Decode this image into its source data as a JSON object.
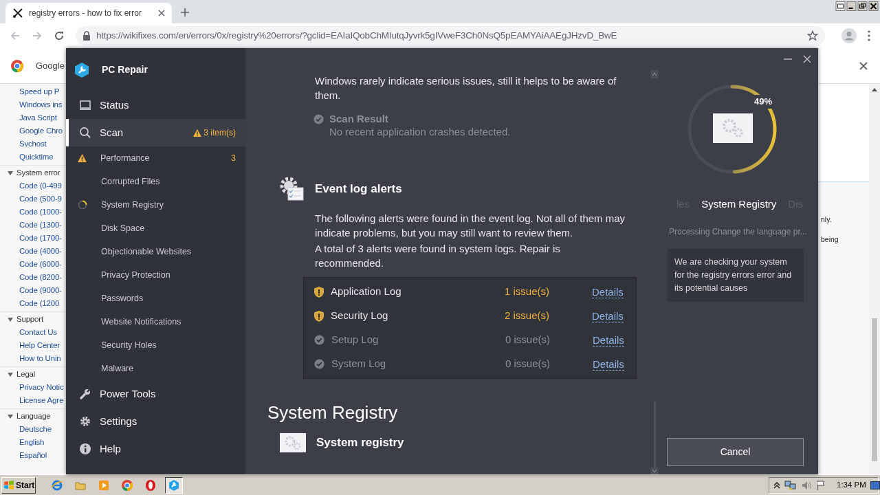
{
  "browser": {
    "tab": {
      "title": "registry errors - how to fix error"
    },
    "url": "https://wikifixes.com/en/errors/0x/registry%20errors/?gclid=EAIaIQobChMIutqJyvrk5gIVweF3Ch0NsQ5pEAMYAiAAEgJHzvD_BwE",
    "infobar": {
      "text": "Google"
    }
  },
  "page": {
    "links": [
      "Speed up P",
      "Windows ins",
      "Java Script",
      "Google Chro",
      "Svchost",
      "Quicktime"
    ],
    "groups": [
      {
        "title": "System error",
        "expanded": true,
        "children": [
          "Code (0-499",
          "Code (500-9",
          "Code (1000-",
          "Code (1300-",
          "Code (1700-",
          "Code (4000-",
          "Code (6000-",
          "Code (8200-",
          "Code (9000-",
          "Code (1200"
        ]
      },
      {
        "title": "Support",
        "expanded": true,
        "children": [
          "Contact Us",
          "Help Center",
          "How to Unin"
        ]
      },
      {
        "title": "Legal",
        "expanded": true,
        "children": [
          "Privacy Notic",
          "License Agre"
        ]
      },
      {
        "title": "Language",
        "expanded": true,
        "children": [
          "Deutsche",
          "English",
          "Español"
        ]
      }
    ],
    "right_texts": [
      "nly.",
      "being"
    ]
  },
  "app": {
    "title": "PC Repair",
    "sidebar": {
      "items": [
        {
          "kind": "main",
          "label": "Status",
          "selected": false
        },
        {
          "kind": "main",
          "label": "Scan",
          "selected": true,
          "badge": "3 item(s)"
        },
        {
          "kind": "sub",
          "label": "Performance",
          "warning": true,
          "scanning": false,
          "count": "3"
        },
        {
          "kind": "sub",
          "label": "Corrupted Files",
          "warning": false,
          "scanning": false
        },
        {
          "kind": "sub",
          "label": "System Registry",
          "warning": false,
          "scanning": true
        },
        {
          "kind": "sub",
          "label": "Disk Space",
          "warning": false,
          "scanning": false
        },
        {
          "kind": "sub",
          "label": "Objectionable Websites",
          "warning": false,
          "scanning": false
        },
        {
          "kind": "sub",
          "label": "Privacy Protection",
          "warning": false,
          "scanning": false
        },
        {
          "kind": "sub",
          "label": "Passwords",
          "warning": false,
          "scanning": false
        },
        {
          "kind": "sub",
          "label": "Website Notifications",
          "warning": false,
          "scanning": false
        },
        {
          "kind": "sub",
          "label": "Security Holes",
          "warning": false,
          "scanning": false
        },
        {
          "kind": "sub",
          "label": "Malware",
          "warning": false,
          "scanning": false
        },
        {
          "kind": "main",
          "label": "Power Tools",
          "selected": false
        },
        {
          "kind": "main",
          "label": "Settings",
          "selected": false
        },
        {
          "kind": "main",
          "label": "Help",
          "selected": false
        }
      ]
    },
    "content": {
      "intro": "Windows rarely indicate serious issues, still it helps to be aware of them.",
      "scan_result": {
        "title": "Scan Result",
        "text": "No recent application crashes detected."
      },
      "event_log": {
        "title": "Event log alerts",
        "paragraphs": [
          "The following alerts were found in the event log. Not all of them may indicate problems, but you may still want to review them.",
          "A total of 3 alerts were found in system logs. Repair is recommended."
        ],
        "rows": [
          {
            "name": "Application Log",
            "warning": true,
            "issues": "1 issue(s)",
            "link": "Details"
          },
          {
            "name": "Security Log",
            "warning": true,
            "issues": "2 issue(s)",
            "link": "Details"
          },
          {
            "name": "Setup Log",
            "warning": false,
            "issues": "0 issue(s)",
            "link": "Details"
          },
          {
            "name": "System Log",
            "warning": false,
            "issues": "0 issue(s)",
            "link": "Details"
          }
        ]
      },
      "section_title": "System Registry",
      "section_item": "System registry"
    },
    "progress": {
      "level": 0.49,
      "label": "49%"
    },
    "carousel": [
      {
        "label": "les",
        "selected": false
      },
      {
        "label": "System Registry",
        "selected": true
      },
      {
        "label": "Dis",
        "selected": false
      }
    ],
    "processing": "Processing Change the language pr...",
    "info": "We are checking your system for the registry errors error and its potential causes",
    "cancel": "Cancel"
  },
  "taskbar": {
    "start": "Start",
    "apps": [
      {
        "selected": false
      },
      {
        "selected": false
      },
      {
        "selected": false
      },
      {
        "selected": false
      },
      {
        "selected": false
      },
      {
        "selected": true
      }
    ],
    "clock": "1:34 PM"
  }
}
